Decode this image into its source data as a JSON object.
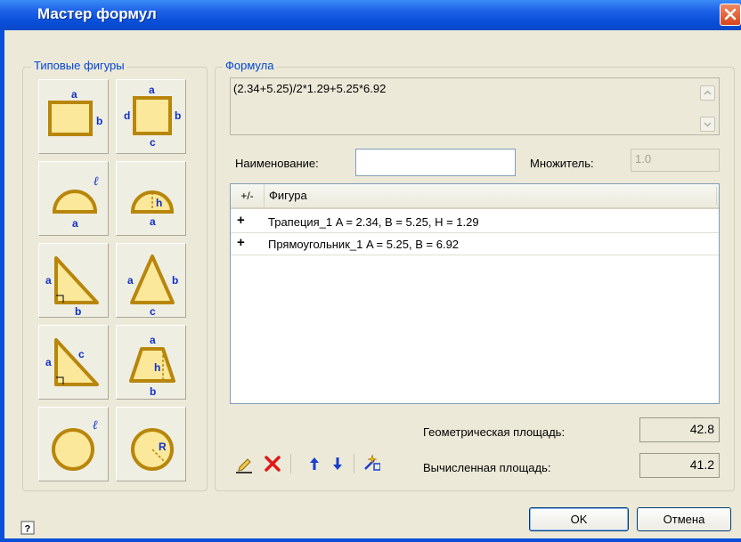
{
  "window": {
    "title": "Мастер формул"
  },
  "groups": {
    "shapes_legend": "Типовые фигуры",
    "formula_legend": "Формула"
  },
  "shapes": [
    {
      "name": "rectangle-3-sides",
      "labels": [
        "a",
        "b"
      ]
    },
    {
      "name": "quadrilateral-4-sides",
      "labels": [
        "a",
        "b",
        "c",
        "d"
      ]
    },
    {
      "name": "semicircle-arc",
      "labels": [
        "ℓ",
        "a"
      ]
    },
    {
      "name": "semicircle-height",
      "labels": [
        "h",
        "a"
      ]
    },
    {
      "name": "right-triangle-legs",
      "labels": [
        "a",
        "b"
      ]
    },
    {
      "name": "triangle-3-sides",
      "labels": [
        "a",
        "b",
        "c"
      ]
    },
    {
      "name": "right-triangle-hypotenuse",
      "labels": [
        "a",
        "c"
      ]
    },
    {
      "name": "trapezoid",
      "labels": [
        "a",
        "h",
        "b"
      ]
    },
    {
      "name": "circle-circumference",
      "labels": [
        "ℓ"
      ]
    },
    {
      "name": "circle-radius",
      "labels": [
        "R"
      ]
    }
  ],
  "formula": {
    "text": "(2.34+5.25)/2*1.29+5.25*6.92"
  },
  "name_field": {
    "label": "Наименование:",
    "value": ""
  },
  "multiplier": {
    "label": "Множитель:",
    "value": "1.0"
  },
  "table": {
    "columns": [
      "+/-",
      "Фигура"
    ],
    "rows": [
      {
        "sign": "+",
        "text": "Трапеция_1 A = 2.34, B = 5.25, H = 1.29"
      },
      {
        "sign": "+",
        "text": "Прямоугольник_1 A = 5.25, B = 6.92"
      }
    ]
  },
  "areas": {
    "geometric_label": "Геометрическая площадь:",
    "geometric_value": "42.8",
    "calculated_label": "Вычисленная площадь:",
    "calculated_value": "41.2"
  },
  "buttons": {
    "ok": "OK",
    "cancel": "Отмена"
  },
  "toolbar_icons": [
    "pencil-edit-icon",
    "delete-x-icon",
    "arrow-up-icon",
    "arrow-down-icon",
    "wizard-icon"
  ],
  "colors": {
    "title_bar": "#0a4fd8",
    "legend_text": "#0046d5",
    "shape_fill": "#fbe89a",
    "shape_stroke": "#b8860b",
    "label_blue": "#1030c8"
  }
}
